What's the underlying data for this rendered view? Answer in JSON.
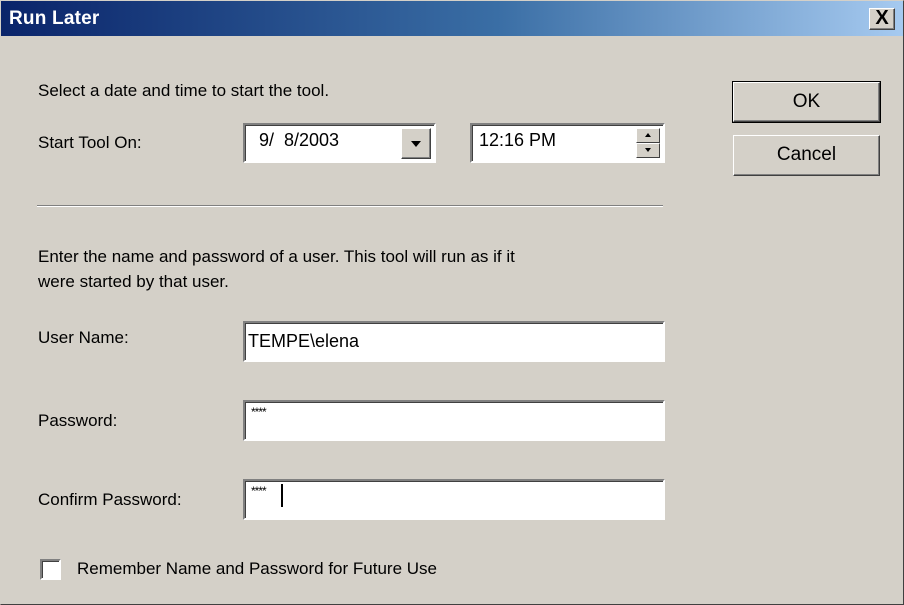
{
  "window": {
    "title": "Run Later",
    "close_label": "X"
  },
  "schedule": {
    "instruction": "Select a date and time to start the tool.",
    "start_label": "Start Tool On:",
    "date_value": "9/  8/2003",
    "time_value": "12:16 PM"
  },
  "credentials": {
    "instruction_line1": "Enter the name and password of a user.  This tool will run as if it",
    "instruction_line2": "were started by that user.",
    "username_label": "User Name:",
    "username_value": "TEMPE\\elena",
    "password_label": "Password:",
    "password_value": "****",
    "confirm_label": "Confirm Password:",
    "confirm_value": "****",
    "remember_label": "Remember Name and Password for Future Use",
    "remember_checked": false
  },
  "buttons": {
    "ok_label": "OK",
    "cancel_label": "Cancel"
  },
  "icons": {
    "dropdown": "chevron-down-icon",
    "spin_up": "spin-up-icon",
    "spin_down": "spin-down-icon",
    "close": "close-icon"
  }
}
